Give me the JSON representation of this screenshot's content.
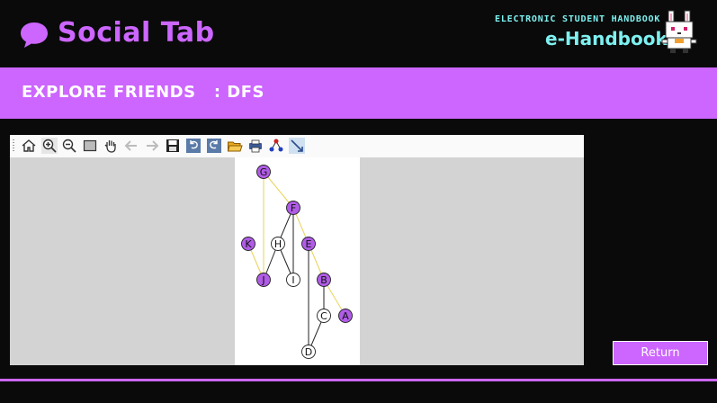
{
  "header": {
    "title": "Social Tab",
    "handbook_subtitle": "ELECTRONIC STUDENT HANDBOOK",
    "handbook_title": "e-Handbook",
    "icon": "chat-bubble-icon",
    "mascot": "bunny-mascot"
  },
  "banner": {
    "text": "EXPLORE FRIENDS   : DFS"
  },
  "toolbar": {
    "buttons": [
      "home-icon",
      "zoom-in-icon",
      "zoom-out-icon",
      "rect-select-icon",
      "pan-hand-icon",
      "back-arrow-icon",
      "forward-arrow-icon",
      "save-icon",
      "undo-icon",
      "redo-icon",
      "open-folder-icon",
      "print-icon",
      "graph-layout-icon",
      "fit-diagonal-icon"
    ]
  },
  "graph": {
    "nodes": [
      {
        "id": "G",
        "label": "G",
        "visited": true
      },
      {
        "id": "F",
        "label": "F",
        "visited": true
      },
      {
        "id": "K",
        "label": "K",
        "visited": true
      },
      {
        "id": "H",
        "label": "H",
        "visited": false
      },
      {
        "id": "E",
        "label": "E",
        "visited": true
      },
      {
        "id": "J",
        "label": "J",
        "visited": true
      },
      {
        "id": "I",
        "label": "I",
        "visited": false
      },
      {
        "id": "B",
        "label": "B",
        "visited": true
      },
      {
        "id": "A",
        "label": "A",
        "visited": true
      },
      {
        "id": "C",
        "label": "C",
        "visited": false
      },
      {
        "id": "D",
        "label": "D",
        "visited": false
      }
    ],
    "edges": [
      {
        "from": "G",
        "to": "F",
        "traversed": true
      },
      {
        "from": "G",
        "to": "J",
        "traversed": true
      },
      {
        "from": "F",
        "to": "E",
        "traversed": true
      },
      {
        "from": "F",
        "to": "H",
        "traversed": false
      },
      {
        "from": "F",
        "to": "I",
        "traversed": false
      },
      {
        "from": "K",
        "to": "J",
        "traversed": true
      },
      {
        "from": "H",
        "to": "J",
        "traversed": false
      },
      {
        "from": "H",
        "to": "I",
        "traversed": false
      },
      {
        "from": "E",
        "to": "B",
        "traversed": true
      },
      {
        "from": "E",
        "to": "D",
        "traversed": false
      },
      {
        "from": "B",
        "to": "A",
        "traversed": true
      },
      {
        "from": "B",
        "to": "C",
        "traversed": false
      },
      {
        "from": "C",
        "to": "D",
        "traversed": false
      }
    ],
    "colors": {
      "visited": "#b05ce6",
      "unvisited": "#ffffff",
      "traversed_edge": "#e8d35a",
      "edge": "#222222"
    }
  },
  "return_button": {
    "label": "Return"
  },
  "colors": {
    "accent": "#cc66ff",
    "cyan": "#7ef0f0",
    "background": "#0a0a0a"
  }
}
